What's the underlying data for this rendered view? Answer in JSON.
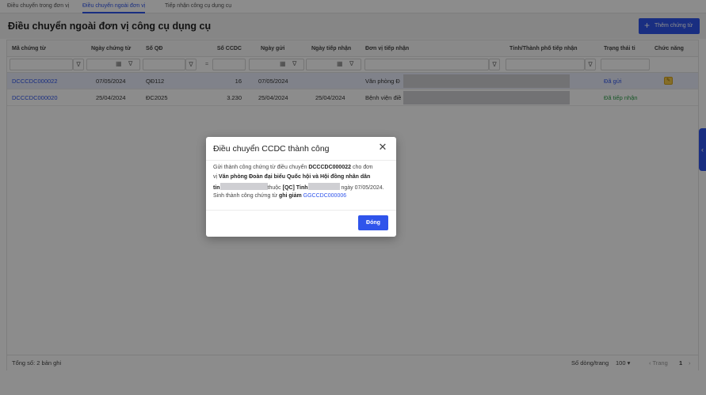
{
  "tabs": [
    {
      "label": "Điều chuyển trong đơn vị"
    },
    {
      "label": "Điều chuyển ngoài đơn vị"
    },
    {
      "label": "Tiếp nhận công cụ dụng cụ"
    }
  ],
  "header": {
    "title": "Điều chuyển ngoài đơn vị công cụ dụng cụ",
    "add_button": {
      "icon": "plus-icon",
      "label": "Thêm chứng từ"
    }
  },
  "table": {
    "columns": [
      "Mã chứng từ",
      "Ngày chứng từ",
      "Số QĐ",
      "Số CCDC",
      "Ngày gửi",
      "Ngày tiếp nhận",
      "Đơn vị tiếp nhận",
      "Tỉnh/Thành phố tiếp nhận",
      "Trạng thái ti",
      "Chức năng"
    ],
    "filter_eq_symbol": "=",
    "rows": [
      {
        "code": "DCCCDC000022",
        "doc_date": "07/05/2024",
        "decision_no": "QĐ112",
        "qty": "16",
        "sent_date": "07/05/2024",
        "recv_date": "",
        "unit": "Văn phòng Đ",
        "status": "Đã gửi"
      },
      {
        "code": "DCCCDC000020",
        "doc_date": "25/04/2024",
        "decision_no": "ĐC2025",
        "qty": "3.230",
        "sent_date": "25/04/2024",
        "recv_date": "25/04/2024",
        "unit": "Bệnh viện điề",
        "status": "Đã tiếp nhận"
      }
    ],
    "status_colors": {
      "sent": "#2f54eb",
      "received": "#2e9e4a"
    }
  },
  "footer": {
    "total": "Tổng số: 2 bản ghi",
    "page_size_label": "Số dòng/trang",
    "page_size_value": "100",
    "prev_label": "Trang",
    "page_number": "1"
  },
  "modal": {
    "title": "Điều chuyển CCDC thành công",
    "line1_pre": "Gửi thành công chứng từ điều chuyển ",
    "line1_code": "DCCCDC000022",
    "line1_post": " cho đơn",
    "line2_pre": "vị ",
    "line2_unit": "Văn phòng Đoàn đại biểu Quốc hội và Hội đồng nhân dân",
    "line3_a": "tỉn",
    "line3_b": "thuộc ",
    "line3_c": "[QC] Tỉnh",
    "line3_d": " ngày 07/05/2024.",
    "line4_pre": "Sinh thành công chứng từ ",
    "line4_bold": "ghi giảm",
    "line4_code": " GGCCDC000006",
    "close_button": "Đóng"
  },
  "colors": {
    "accent": "#2f54eb"
  }
}
